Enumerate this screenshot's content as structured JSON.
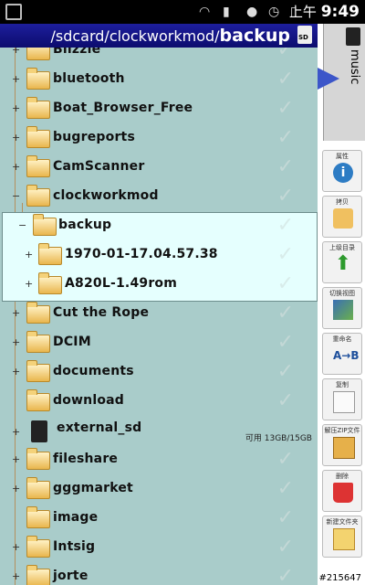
{
  "status_bar": {
    "time_prefix": "上午",
    "time": "9:49",
    "icons": [
      "download-icon",
      "wifi-icon",
      "signal-icon",
      "app-icon",
      "alarm-icon",
      "battery-icon"
    ]
  },
  "path_bar": {
    "path_prefix": "/sdcard/clockworkmod/",
    "path_current": "backup"
  },
  "music_tab": {
    "label": "music"
  },
  "files": [
    {
      "name": "Bilzzie",
      "expander": "+"
    },
    {
      "name": "bluetooth",
      "expander": "+"
    },
    {
      "name": "Boat_Browser_Free",
      "expander": "+"
    },
    {
      "name": "bugreports",
      "expander": "+"
    },
    {
      "name": "CamScanner",
      "expander": "+"
    },
    {
      "name": "clockworkmod",
      "expander": "−"
    },
    {
      "name": "backup",
      "expander": "−"
    },
    {
      "name": "1970-01-17.04.57.38",
      "expander": "+"
    },
    {
      "name": "A820L-1.49rom",
      "expander": "+"
    },
    {
      "name": "Cut the Rope",
      "expander": "+"
    },
    {
      "name": "DCIM",
      "expander": "+"
    },
    {
      "name": "documents",
      "expander": "+"
    },
    {
      "name": "download",
      "expander": ""
    },
    {
      "name": "external_sd",
      "expander": "+",
      "info": "可用 13GB/15GB"
    },
    {
      "name": "fileshare",
      "expander": "+"
    },
    {
      "name": "gggmarket",
      "expander": "+"
    },
    {
      "name": "image",
      "expander": ""
    },
    {
      "name": "Intsig",
      "expander": "+"
    },
    {
      "name": "jorte",
      "expander": "+"
    }
  ],
  "tools": [
    {
      "label": "属性",
      "icon": "info-icon"
    },
    {
      "label": "拷贝",
      "icon": "copy-icon"
    },
    {
      "label": "上级目录",
      "icon": "up-arrow-icon"
    },
    {
      "label": "切换视图",
      "icon": "view-icon"
    },
    {
      "label": "重命名",
      "icon": "rename-icon"
    },
    {
      "label": "复制",
      "icon": "paste-icon"
    },
    {
      "label": "解压ZIP文件",
      "icon": "zip-icon"
    },
    {
      "label": "删除",
      "icon": "trash-icon"
    },
    {
      "label": "新建文件夹",
      "icon": "new-folder-icon"
    }
  ],
  "watermark": "#215647",
  "colors": {
    "path_bar": "#1d1e9c",
    "list_bg": "#a9ccca",
    "selection_bg": "#e5fffe",
    "arrow": "#3c56c9"
  }
}
